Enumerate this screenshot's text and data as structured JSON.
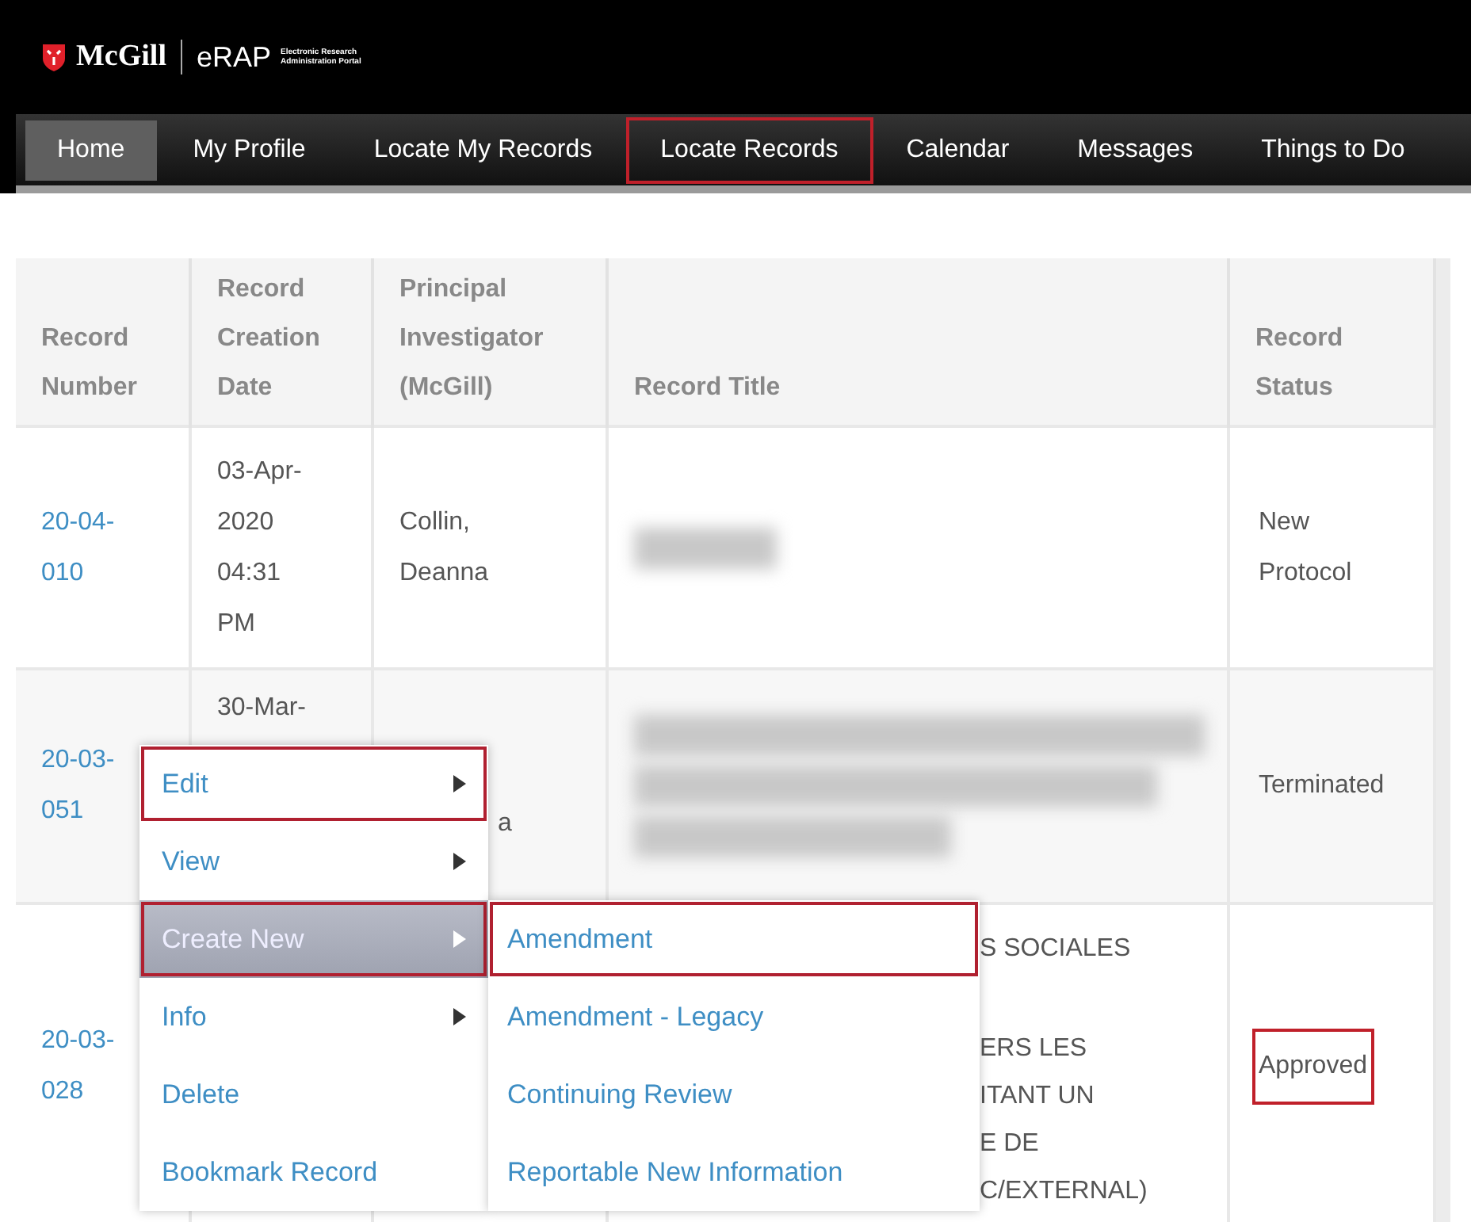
{
  "brand": {
    "university": "McGill",
    "app": "eRAP",
    "tagline_1": "Electronic Research",
    "tagline_2": "Administration Portal"
  },
  "nav": [
    {
      "label": "Home",
      "selected": true,
      "highlighted": false
    },
    {
      "label": "My Profile",
      "selected": false,
      "highlighted": false
    },
    {
      "label": "Locate My Records",
      "selected": false,
      "highlighted": false
    },
    {
      "label": "Locate Records",
      "selected": false,
      "highlighted": true
    },
    {
      "label": "Calendar",
      "selected": false,
      "highlighted": false
    },
    {
      "label": "Messages",
      "selected": false,
      "highlighted": false
    },
    {
      "label": "Things to Do",
      "selected": false,
      "highlighted": false
    }
  ],
  "table": {
    "columns": [
      "Record Number",
      "Record Creation Date",
      "Principal Investigator (McGill)",
      "Record Title",
      "Record Status"
    ],
    "rows": [
      {
        "number": "20-04-010",
        "date": "03-Apr-2020 04:31 PM",
        "investigator": "Collin, Deanna",
        "title": {
          "kind": "redacted"
        },
        "status": "New Protocol",
        "status_highlighted": false
      },
      {
        "number": "20-03-051",
        "date": "30-Mar-",
        "investigator": "a",
        "title": {
          "kind": "redacted_block"
        },
        "status": "Terminated",
        "status_highlighted": false
      },
      {
        "number": "20-03-028",
        "title": {
          "kind": "partial",
          "lines_text": [
            "S SOCIALES",
            "ERS LES",
            "ITANT UN",
            "E DE",
            "C/EXTERNAL)"
          ]
        },
        "status": "Approved",
        "status_highlighted": true
      }
    ]
  },
  "context_menu": {
    "items": [
      {
        "label": "Edit",
        "submenu": true,
        "selected": false,
        "highlighted": true
      },
      {
        "label": "View",
        "submenu": true,
        "selected": false,
        "highlighted": false
      },
      {
        "label": "Create New",
        "submenu": true,
        "selected": true,
        "highlighted": true
      },
      {
        "label": "Info",
        "submenu": true,
        "selected": false,
        "highlighted": false
      },
      {
        "label": "Delete",
        "submenu": false,
        "selected": false,
        "highlighted": false
      },
      {
        "label": "Bookmark Record",
        "submenu": false,
        "selected": false,
        "highlighted": false
      }
    ]
  },
  "submenu": {
    "items": [
      {
        "label": "Amendment",
        "highlighted": true
      },
      {
        "label": "Amendment - Legacy",
        "highlighted": false
      },
      {
        "label": "Continuing Review",
        "highlighted": false
      },
      {
        "label": "Reportable New Information",
        "highlighted": false
      }
    ]
  }
}
